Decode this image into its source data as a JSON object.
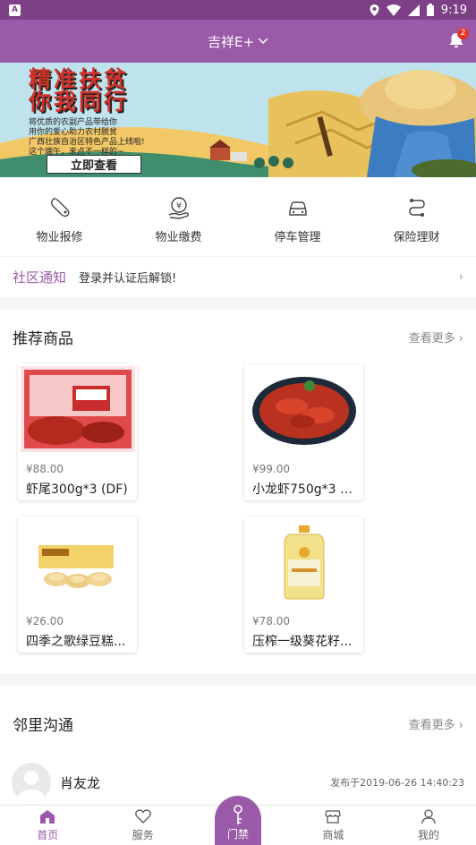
{
  "status": {
    "time": "9:19",
    "app_badge": "A"
  },
  "header": {
    "community": "吉祥E+",
    "notification_count": "2"
  },
  "banner": {
    "headline_1": "精准扶贫",
    "headline_2": "你我同行",
    "sub_lines": [
      "将优质的农副产品带给你",
      "用你的爱心助力农村脱贫",
      "广西壮族自治区特色产品上线啦!",
      "这个端午，来点不一样的~"
    ],
    "button": "立即查看"
  },
  "services": [
    {
      "label": "物业报修",
      "icon": "wrench-icon"
    },
    {
      "label": "物业缴费",
      "icon": "payment-icon"
    },
    {
      "label": "停车管理",
      "icon": "car-icon"
    },
    {
      "label": "保险理财",
      "icon": "finance-icon"
    }
  ],
  "notice": {
    "tag": "社区通知",
    "text": "登录并认证后解锁!"
  },
  "recommended": {
    "title": "推荐商品",
    "more": "查看更多",
    "products": [
      {
        "price": "¥88.00",
        "name": "虾尾300g*3 (DF)"
      },
      {
        "price": "¥99.00",
        "name": "小龙虾750g*3 (..."
      },
      {
        "price": "¥26.00",
        "name": "四季之歌绿豆糕..."
      },
      {
        "price": "¥78.00",
        "name": "压榨一级葵花籽..."
      }
    ]
  },
  "neighbors": {
    "title": "邻里沟通",
    "more": "查看更多",
    "post": {
      "author": "肖友龙",
      "time": "发布于2019-06-26 14:40:23"
    }
  },
  "tabs": {
    "home": "首页",
    "service": "服务",
    "door": "门禁",
    "mall": "商城",
    "mine": "我的"
  },
  "colors": {
    "primary": "#9b5aa8",
    "status_bar": "#7d3f86",
    "badge": "#e8352b"
  }
}
